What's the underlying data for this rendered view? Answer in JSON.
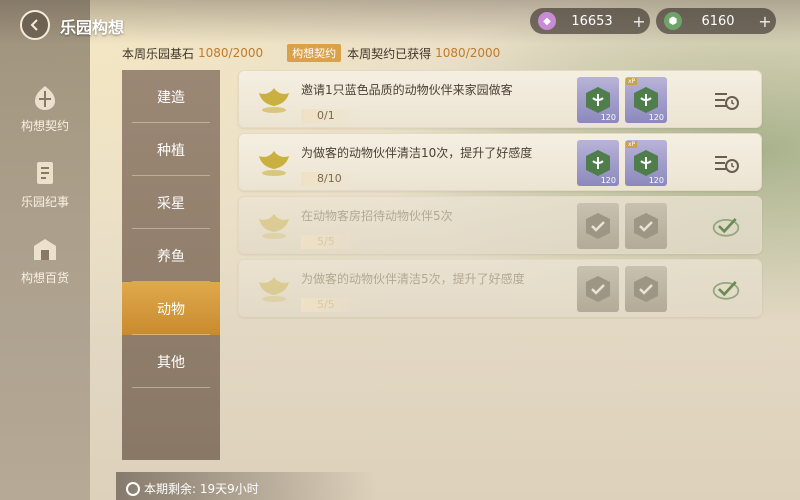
{
  "header": {
    "title": "乐园构想",
    "currency": [
      {
        "icon": "pink-gem-icon",
        "value": "16653",
        "color": "#c98ad6"
      },
      {
        "icon": "green-gem-icon",
        "value": "6160",
        "color": "#6fa36a"
      }
    ]
  },
  "sidebar": {
    "items": [
      {
        "label": "构想契约",
        "icon": "contract-icon"
      },
      {
        "label": "乐园纪事",
        "icon": "chronicle-icon"
      },
      {
        "label": "构想百货",
        "icon": "store-icon"
      }
    ]
  },
  "stats": {
    "weekly_base_label": "本周乐园基石",
    "weekly_base_value": "1080/2000",
    "contract_badge": "构想契约",
    "weekly_contract_label": "本周契约已获得",
    "weekly_contract_value": "1080/2000"
  },
  "categories": [
    {
      "label": "建造",
      "active": false
    },
    {
      "label": "种植",
      "active": false
    },
    {
      "label": "采星",
      "active": false
    },
    {
      "label": "养鱼",
      "active": false
    },
    {
      "label": "动物",
      "active": true
    },
    {
      "label": "其他",
      "active": false
    }
  ],
  "tasks": [
    {
      "title": "邀请1只蓝色品质的动物伙伴来家园做客",
      "progress": "0/1",
      "done": false,
      "rewards": [
        {
          "count": "120"
        },
        {
          "count": "120",
          "tag": "xP"
        }
      ],
      "action_icon": "tasks-clock-icon"
    },
    {
      "title": "为做客的动物伙伴清洁10次，提升了好感度",
      "progress": "8/10",
      "done": false,
      "rewards": [
        {
          "count": "120"
        },
        {
          "count": "120",
          "tag": "xP"
        }
      ],
      "action_icon": "tasks-clock-icon"
    },
    {
      "title": "在动物客房招待动物伙伴5次",
      "progress": "5/5",
      "done": true,
      "rewards": [
        {
          "count": ""
        },
        {
          "count": ""
        }
      ],
      "action_icon": "checkmark-icon"
    },
    {
      "title": "为做客的动物伙伴清洁5次，提升了好感度",
      "progress": "5/5",
      "done": true,
      "rewards": [
        {
          "count": ""
        },
        {
          "count": ""
        }
      ],
      "action_icon": "checkmark-icon"
    }
  ],
  "timer": {
    "label": "本期剩余: 19天9小时"
  },
  "colors": {
    "accent": "#c07a2a",
    "active_tab": "#d59a3c",
    "badge": "#d8a14a"
  }
}
